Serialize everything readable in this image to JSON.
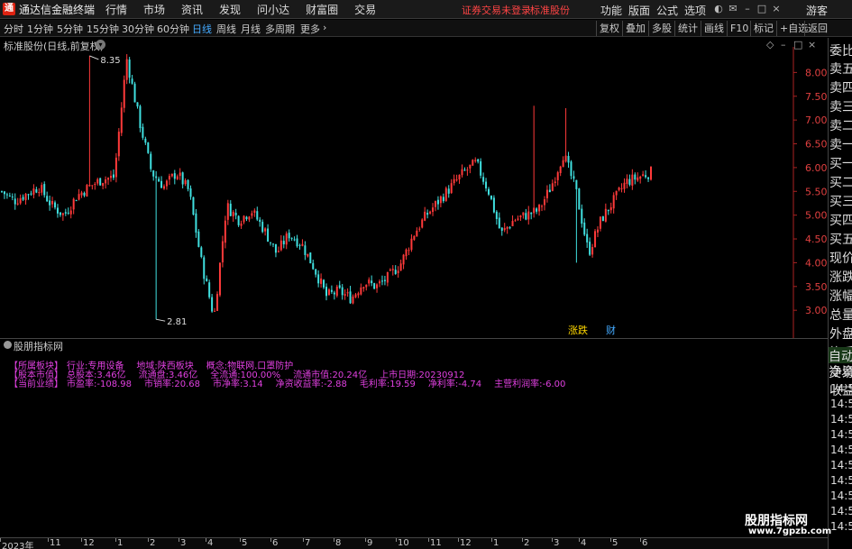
{
  "app": {
    "title": "通达信金融终端",
    "logo_glyph": "通",
    "menu": [
      "行情",
      "市场",
      "资讯",
      "发现",
      "问小达",
      "财富圈",
      "交易"
    ],
    "login_status": "证券交易未登录",
    "stock_title": "标准股份",
    "right_menu": [
      "功能",
      "版面",
      "公式",
      "选项"
    ],
    "guest": "游客"
  },
  "tabs": {
    "periods": [
      "分时",
      "1分钟",
      "5分钟",
      "15分钟",
      "30分钟",
      "60分钟",
      "日线",
      "周线",
      "月线",
      "多周期",
      "更多"
    ],
    "active": "日线",
    "tools": [
      "复权",
      "叠加",
      "多股",
      "统计",
      "画线",
      "F10",
      "标记",
      "+自选",
      "返回"
    ]
  },
  "chart": {
    "title": "标准股份(日线,前复权)",
    "price_ticks": [
      "8.00",
      "7.50",
      "7.00",
      "6.50",
      "6.00",
      "5.50",
      "5.00",
      "4.50",
      "4.00",
      "3.50",
      "3.00"
    ],
    "high_label": "8.35",
    "low_label": "2.81",
    "annot_rise_fall": "涨跌",
    "annot_finance": "财"
  },
  "chart_data": {
    "type": "candlestick",
    "title": "标准股份(日线,前复权)",
    "ylim": [
      2.7,
      8.5
    ],
    "max_price": 8.35,
    "min_price": 2.81,
    "x_labels": [
      "2023年",
      "11",
      "12",
      "1",
      "2",
      "3",
      "4",
      "5",
      "6",
      "7",
      "8",
      "9",
      "10",
      "11",
      "12",
      "1",
      "2",
      "3",
      "4",
      "5",
      "6"
    ],
    "close_path": [
      5.5,
      5.3,
      5.45,
      5.6,
      5.2,
      5.0,
      5.4,
      5.6,
      5.75,
      5.8,
      8.3,
      7.0,
      5.9,
      5.6,
      5.9,
      5.5,
      4.0,
      2.85,
      5.2,
      4.9,
      5.1,
      4.7,
      4.2,
      4.6,
      4.4,
      3.9,
      3.3,
      3.4,
      3.25,
      3.6,
      3.5,
      3.7,
      4.0,
      4.6,
      5.0,
      5.3,
      5.6,
      5.9,
      6.1,
      5.5,
      4.6,
      4.9,
      5.0,
      5.1,
      5.6,
      6.3,
      5.5,
      4.2,
      4.9,
      5.3,
      5.7,
      5.8,
      5.9
    ]
  },
  "indicator": {
    "title": "股朋指标网",
    "rows": [
      {
        "label": "【所属板块】",
        "values": [
          "行业:专用设备",
          "地域:陕西板块",
          "概念:物联网.口罩防护"
        ]
      },
      {
        "label": "【股本市值】",
        "values": [
          "总股本:3.46亿",
          "流通盘:3.46亿",
          "全流通:100.00%",
          "流通市值:20.24亿",
          "上市日期:20230912"
        ]
      },
      {
        "label": "【当前业绩】",
        "values": [
          "市盈率:-108.98",
          "市销率:20.68",
          "市净率:3.14",
          "净资收益率:-2.88",
          "毛利率:19.59",
          "净利率:-4.74",
          "主营利润率:-6.00"
        ]
      }
    ]
  },
  "sidebar": {
    "items": [
      "委比",
      "卖五",
      "卖四",
      "卖三",
      "卖二",
      "卖一",
      "买一",
      "买二",
      "买三",
      "买四",
      "买五",
      "现价",
      "涨跌",
      "涨幅",
      "总量",
      "外盘",
      "换手",
      "净资",
      "收益"
    ],
    "tabs": [
      "自动",
      "交易"
    ],
    "times": [
      "14:5",
      "14:5",
      "14:5",
      "14:5",
      "14:5",
      "14:5",
      "14:5",
      "14:5",
      "14:5",
      "14:5"
    ]
  },
  "watermark": {
    "line1": "股朋指标网",
    "line2": "www.7gpzb.com"
  },
  "colors": {
    "up": "#ff3a3a",
    "down": "#40e0e0",
    "accent": "#44aaff",
    "info_text": "#e040e0"
  }
}
